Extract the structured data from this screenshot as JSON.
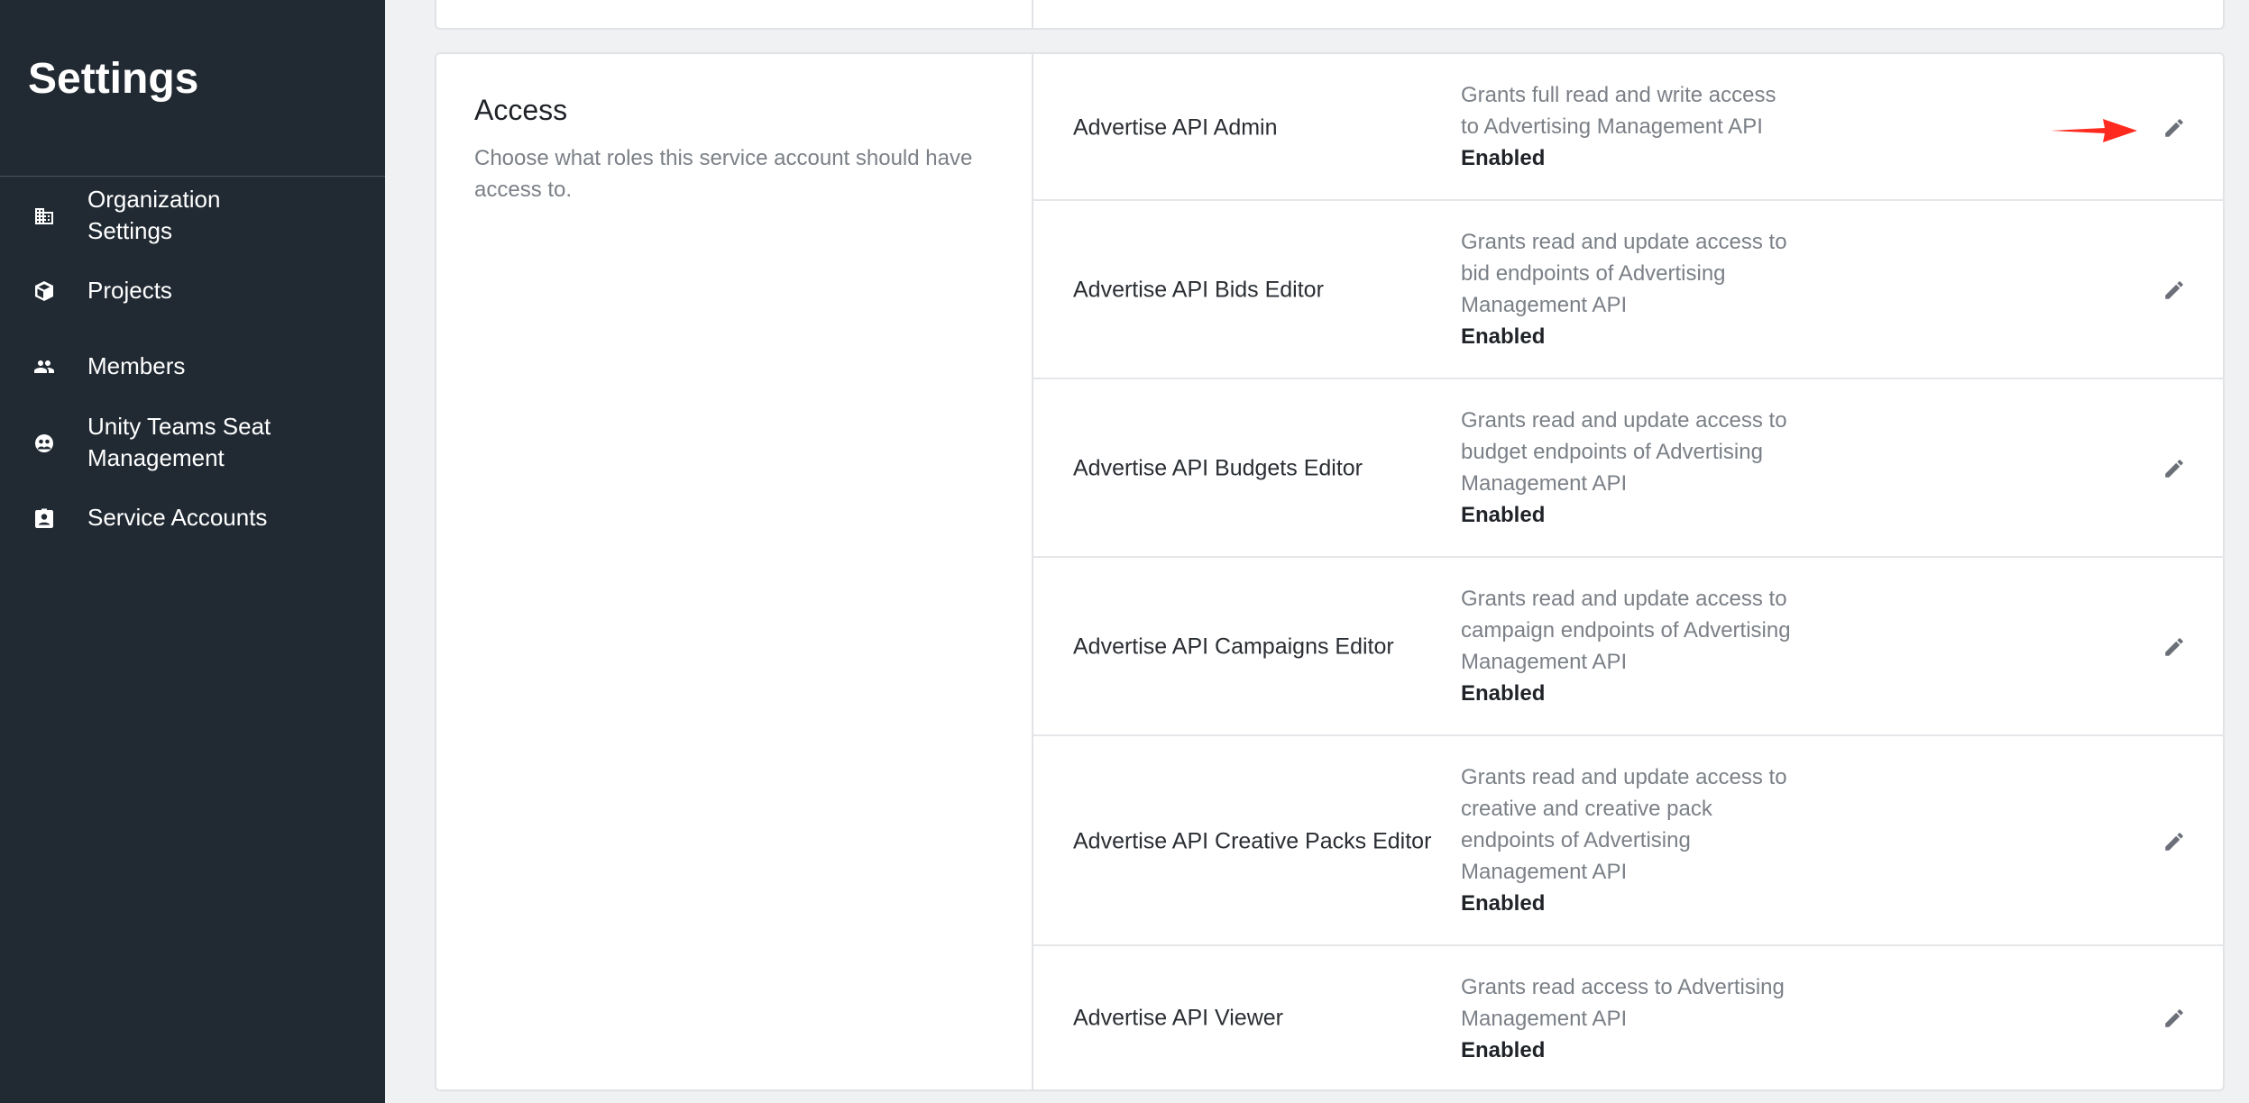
{
  "sidebar": {
    "title": "Settings",
    "items": [
      {
        "label": "Organization\nSettings",
        "icon": "building-icon"
      },
      {
        "label": "Projects",
        "icon": "cube-icon"
      },
      {
        "label": "Members",
        "icon": "people-icon"
      },
      {
        "label": "Unity Teams Seat\nManagement",
        "icon": "teams-icon"
      },
      {
        "label": "Service Accounts",
        "icon": "badge-icon"
      }
    ]
  },
  "access": {
    "title": "Access",
    "description": "Choose what roles this service account should have access to.",
    "roles": [
      {
        "name": "Advertise API Admin",
        "description": "Grants full read and write access\nto Advertising Management API",
        "status": "Enabled"
      },
      {
        "name": "Advertise API Bids Editor",
        "description": "Grants read and update access to\nbid endpoints of Advertising\nManagement API",
        "status": "Enabled"
      },
      {
        "name": "Advertise API Budgets Editor",
        "description": "Grants read and update access to\nbudget endpoints of Advertising\nManagement API",
        "status": "Enabled"
      },
      {
        "name": "Advertise API Campaigns Editor",
        "description": "Grants read and update access to\ncampaign endpoints of Advertising\nManagement API",
        "status": "Enabled"
      },
      {
        "name": "Advertise API Creative Packs Editor",
        "description": "Grants read and update access to\ncreative and creative pack\nendpoints of Advertising\nManagement API",
        "status": "Enabled"
      },
      {
        "name": "Advertise API Viewer",
        "description": "Grants read access to Advertising\nManagement API",
        "status": "Enabled"
      }
    ]
  },
  "colors": {
    "sidebar_bg": "#212a33",
    "page_bg": "#f0f1f3",
    "annotation_arrow": "#ff2a1f",
    "edit_icon": "#6b7078"
  }
}
